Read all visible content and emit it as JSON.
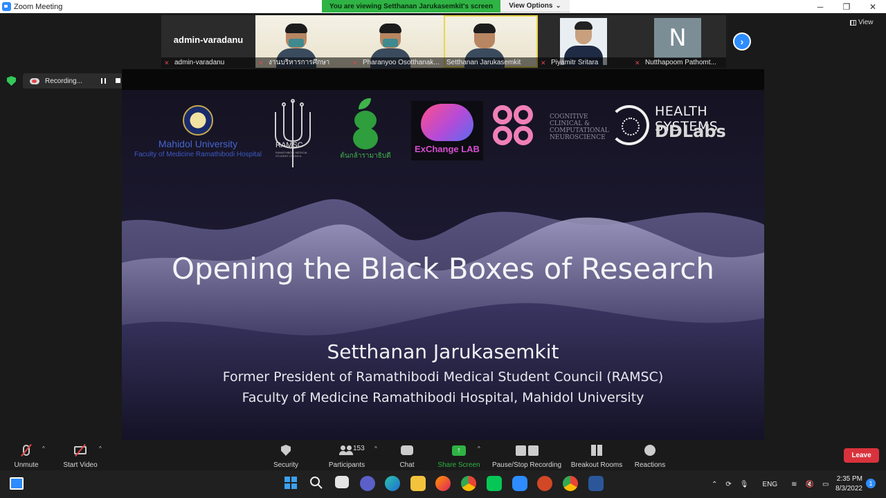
{
  "window": {
    "title": "Zoom Meeting"
  },
  "share_banner": {
    "text": "You are viewing Setthanan Jarukasemkit's screen",
    "view_options_label": "View Options"
  },
  "participants_strip": [
    {
      "name": "admin-varadanu",
      "display_text": "admin-varadanu",
      "type": "text",
      "muted": true
    },
    {
      "name": "งานบริหารการศึกษา",
      "type": "video",
      "muted": true
    },
    {
      "name": "Pharanyoo Osotthanak...",
      "type": "video",
      "muted": true
    },
    {
      "name": "Setthanan Jarukasemkit",
      "type": "video",
      "muted": false,
      "active": true
    },
    {
      "name": "Piyamitr Sritara",
      "type": "portrait",
      "muted": true
    },
    {
      "name": "Nutthapoom Pathomt...",
      "initial": "N",
      "type": "initial",
      "muted": true
    }
  ],
  "view_button_label": "View",
  "recording": {
    "label": "Recording..."
  },
  "slide": {
    "logos": {
      "mahidol_university": "Mahidol University",
      "mahidol_faculty": "Faculty of Medicine Ramathibodi Hospital",
      "ramsc": "RAMSC",
      "ramsc_sub": "RAMATHIBODI MEDICAL STUDENT COUNCIL",
      "tonkla": "ต้นกล้ารามาธิบดี",
      "exchange_lab": "ExChange LAB",
      "ccn_line1": "COGNITIVE",
      "ccn_line2": "CLINICAL &",
      "ccn_line3": "COMPUTATIONAL",
      "ccn_line4": "NEUROSCIENCE",
      "hs_line1": "HEALTH SYSTEMS",
      "hs_line2": "DDLabs"
    },
    "title": "Opening the Black Boxes of Research",
    "presenter": "Setthanan Jarukasemkit",
    "line1": "Former President of Ramathibodi Medical Student Council (RAMSC)",
    "line2": "Faculty of Medicine Ramathibodi Hospital, Mahidol University"
  },
  "toolbar": {
    "unmute": "Unmute",
    "start_video": "Start Video",
    "security": "Security",
    "participants": "Participants",
    "participant_count": "153",
    "chat": "Chat",
    "share_screen": "Share Screen",
    "pause_stop_recording": "Pause/Stop Recording",
    "breakout_rooms": "Breakout Rooms",
    "reactions": "Reactions",
    "leave": "Leave"
  },
  "taskbar": {
    "language": "ENG",
    "time": "2:35 PM",
    "date": "8/3/2022",
    "notifications": "1"
  },
  "colors": {
    "zoom_blue": "#2d8cff",
    "share_green": "#2fb344",
    "leave_red": "#d9323c",
    "muted_red": "#e0454a"
  }
}
